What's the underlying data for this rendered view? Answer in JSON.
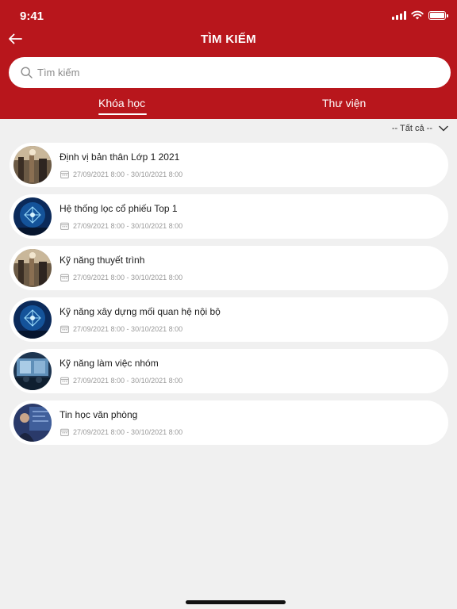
{
  "status_bar": {
    "time": "9:41"
  },
  "header": {
    "title": "TÌM KIẾM",
    "back_icon": "arrow-left-icon"
  },
  "search": {
    "placeholder": "Tìm kiếm",
    "value": "",
    "icon": "search-icon"
  },
  "tabs": [
    {
      "label": "Khóa học",
      "active": true
    },
    {
      "label": "Thư viện",
      "active": false
    }
  ],
  "filter": {
    "label": "-- Tất cả --",
    "icon": "chevron-down-icon"
  },
  "colors": {
    "brand": "#b8161c",
    "background": "#f0f0f0",
    "card": "#ffffff"
  },
  "courses": [
    {
      "title": "Định vị bản thân Lớp 1 2021",
      "date": "27/09/2021 8:00 - 30/10/2021 8:00",
      "thumb": "office"
    },
    {
      "title": "Hệ thống lọc cổ phiếu Top 1",
      "date": "27/09/2021 8:00 - 30/10/2021 8:00",
      "thumb": "network"
    },
    {
      "title": "Kỹ năng thuyết trình",
      "date": "27/09/2021 8:00 - 30/10/2021 8:00",
      "thumb": "office"
    },
    {
      "title": "Kỹ năng xây dựng mối quan hệ nội bộ",
      "date": "27/09/2021 8:00 - 30/10/2021 8:00",
      "thumb": "network"
    },
    {
      "title": "Kỹ năng làm việc nhóm",
      "date": "27/09/2021 8:00 - 30/10/2021 8:00",
      "thumb": "meeting"
    },
    {
      "title": "Tin học văn phòng",
      "date": "27/09/2021 8:00 - 30/10/2021 8:00",
      "thumb": "person"
    }
  ]
}
